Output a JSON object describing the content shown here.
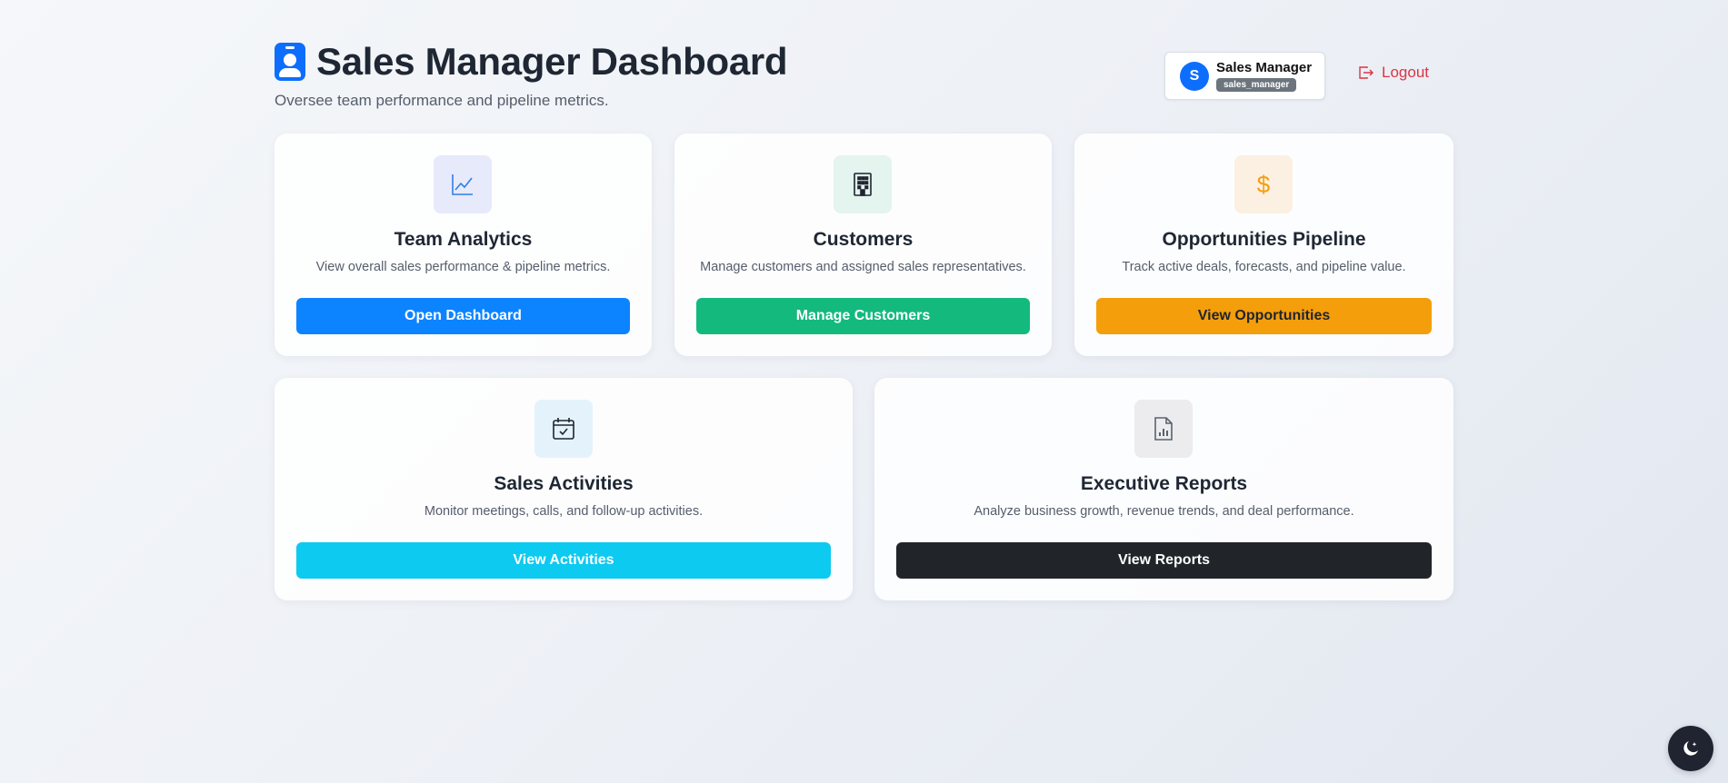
{
  "header": {
    "title": "Sales Manager Dashboard",
    "subtitle": "Oversee team performance and pipeline metrics.",
    "title_icon": "person-badge-icon"
  },
  "user": {
    "avatar_initial": "S",
    "name": "Sales Manager",
    "role": "sales_manager"
  },
  "logout": {
    "label": "Logout",
    "icon": "box-arrow-right-icon"
  },
  "cards": [
    {
      "title": "Team Analytics",
      "description": "View overall sales performance & pipeline metrics.",
      "button": "Open Dashboard",
      "icon": "graph-up-icon",
      "accent": "#0d84ff",
      "tile": "#e6eafb"
    },
    {
      "title": "Customers",
      "description": "Manage customers and assigned sales representatives.",
      "button": "Manage Customers",
      "icon": "building-icon",
      "accent": "#14b97e",
      "tile": "#e4f4ee"
    },
    {
      "title": "Opportunities Pipeline",
      "description": "Track active deals, forecasts, and pipeline value.",
      "button": "View Opportunities",
      "icon": "dollar-icon",
      "accent": "#f59e0b",
      "tile": "#fbf0e2"
    },
    {
      "title": "Sales Activities",
      "description": "Monitor meetings, calls, and follow-up activities.",
      "button": "View Activities",
      "icon": "calendar-check-icon",
      "accent": "#0dcaf0",
      "tile": "#e4f3fb"
    },
    {
      "title": "Executive Reports",
      "description": "Analyze business growth, revenue trends, and deal performance.",
      "button": "View Reports",
      "icon": "file-bar-chart-icon",
      "accent": "#212529",
      "tile": "#ececee"
    }
  ],
  "theme_toggle": {
    "icon": "moon-stars-icon"
  }
}
